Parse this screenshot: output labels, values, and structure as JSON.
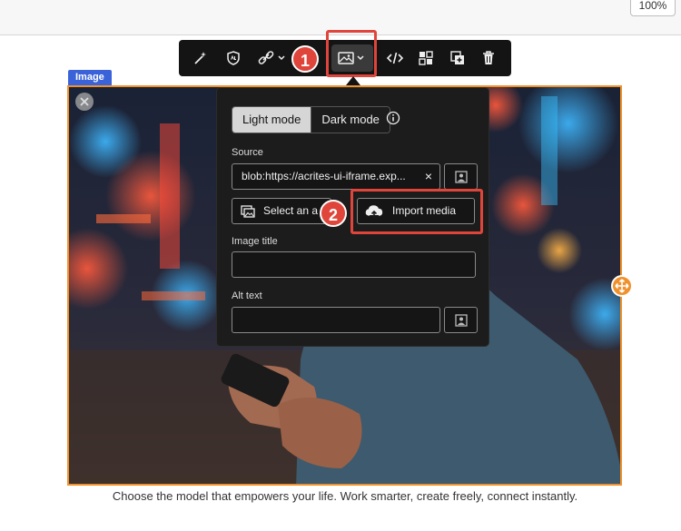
{
  "zoom": "100%",
  "block_label": "Image",
  "caption": "Choose the model that empowers your life. Work smarter, create freely, connect instantly.",
  "toolbar": {
    "buttons": [
      "magic-wand-icon",
      "shield-icon",
      "link-icon",
      "image-icon",
      "code-icon",
      "layout-icon",
      "duplicate-icon",
      "trash-icon"
    ],
    "step1": "1"
  },
  "popover": {
    "mode_light": "Light mode",
    "mode_dark": "Dark mode",
    "source_label": "Source",
    "source_value": "blob:https://acrites-ui-iframe.exp...",
    "clear": "×",
    "select_asset": "Select an a",
    "import_media": "Import media",
    "step2": "2",
    "image_title_label": "Image title",
    "image_title_value": "",
    "alt_text_label": "Alt text",
    "alt_text_value": ""
  },
  "colors": {
    "accent_orange": "#f0912c",
    "callout_red": "#e0453c",
    "label_blue": "#3b63d9",
    "toolbar_bg": "#141414"
  }
}
